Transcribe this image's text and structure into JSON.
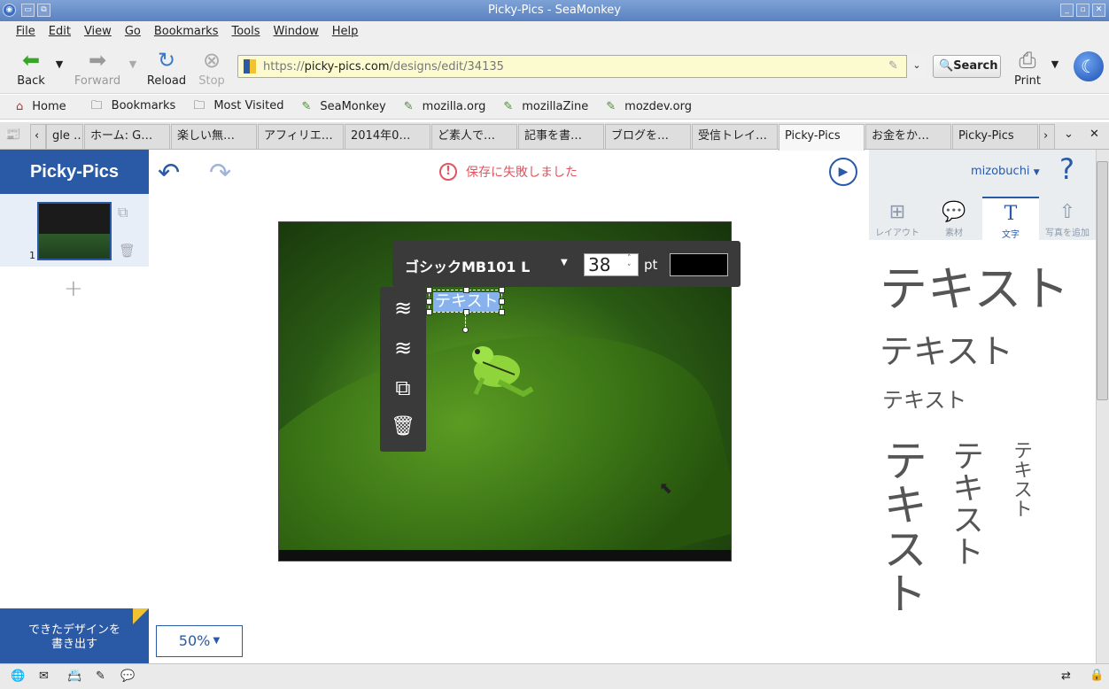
{
  "window": {
    "title": "Picky-Pics - SeaMonkey"
  },
  "menu": [
    "File",
    "Edit",
    "View",
    "Go",
    "Bookmarks",
    "Tools",
    "Window",
    "Help"
  ],
  "toolbar": {
    "back": "Back",
    "forward": "Forward",
    "reload": "Reload",
    "stop": "Stop",
    "url_prefix": "https://",
    "url_domain": "picky-pics.com",
    "url_path": "/designs/edit/34135",
    "search": "Search",
    "print": "Print"
  },
  "bookmarks": [
    "Home",
    "Bookmarks",
    "Most Visited",
    "SeaMonkey",
    "mozilla.org",
    "mozillaZine",
    "mozdev.org"
  ],
  "tabs": [
    "gle …",
    "ホーム: G…",
    "楽しい無…",
    "アフィリエ…",
    "2014年0…",
    "ど素人で…",
    "記事を書…",
    "ブログを…",
    "受信トレイ…",
    "Picky-Pics",
    "お金をか…",
    "Picky-Pics"
  ],
  "app": {
    "brand": "Picky-Pics",
    "save_error": "保存に失敗しました",
    "page_number": "1",
    "add_page": "+",
    "export": [
      "できたデザインを",
      "書き出す"
    ],
    "zoom": "50%",
    "user": "mizobuchi",
    "help": "?",
    "font_name": "ゴシックMB101 L",
    "font_size": "38",
    "font_unit": "pt",
    "text_color": "#000000",
    "selected_text": "テキスト",
    "right_tabs": [
      {
        "label": "レイアウト",
        "icon": "layout-icon"
      },
      {
        "label": "素材",
        "icon": "material-icon"
      },
      {
        "label": "文字",
        "icon": "text-icon"
      },
      {
        "label": "写真を追加",
        "icon": "upload-icon"
      }
    ],
    "text_samples": [
      "テキスト",
      "テキスト",
      "テキスト",
      "テキスト",
      "テキスト",
      "テキスト"
    ],
    "accent": "#2a5aa5",
    "error_color": "#e05560"
  }
}
